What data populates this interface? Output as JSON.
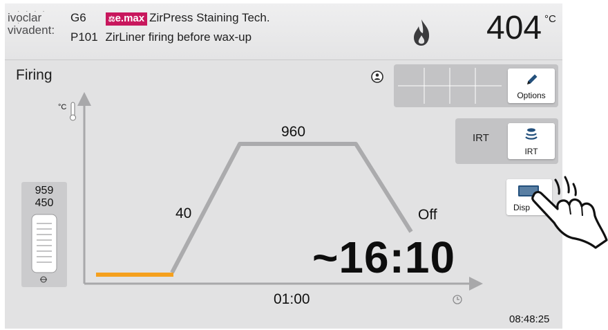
{
  "header": {
    "logo_line1": "ivoclar",
    "logo_line2": "vivadent:",
    "program_code": "G6",
    "program_badge": "e.max",
    "program_name": "ZirPress Staining Tech.",
    "sub_code": "P101",
    "sub_name": "ZirLiner firing before wax-up",
    "temperature": "404",
    "temperature_unit": "°C",
    "heating_icon": "flame-icon"
  },
  "page": {
    "title": "Firing"
  },
  "panel": {
    "options_label": "Options",
    "irt_text": "IRT",
    "irt_button_label": "IRT",
    "display_button_label": "Disp"
  },
  "chart": {
    "y_unit": "°C",
    "rate": "40",
    "hold_temp": "960",
    "end_state": "Off",
    "hold_time": "01:00",
    "remaining_time": "~16:10"
  },
  "thermo": {
    "upper_value": "959",
    "lower_value": "450"
  },
  "clock": "08:48:25",
  "colors": {
    "curve": "#ababad",
    "start_segment": "#f5a01e",
    "badge": "#c8175d"
  }
}
